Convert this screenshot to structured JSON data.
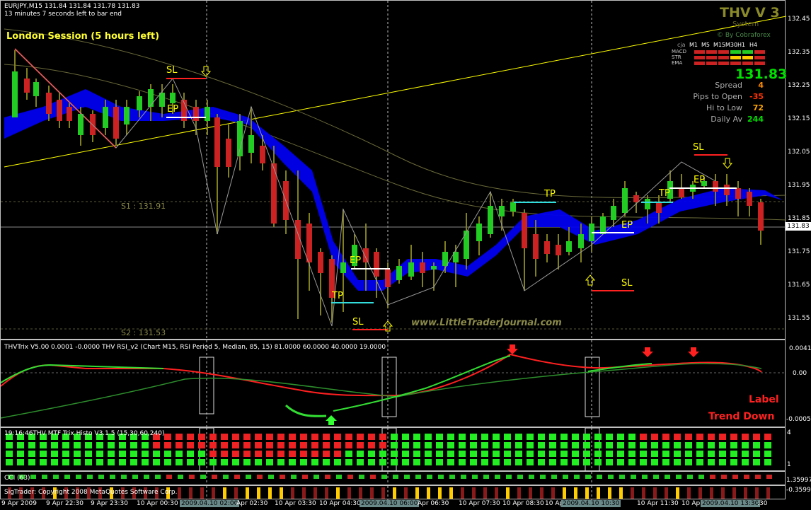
{
  "header": {
    "symbol_line": "EURJPY,M15  131.84 131.84 131.78 131.83",
    "timer_line": "13 minutes 7 seconds left to bar end",
    "session": "London Session (5 hours left)"
  },
  "panel": {
    "title": "THV V 3",
    "subtitle": "System",
    "credit": "© By Cobraforex",
    "tf_headers": [
      "cja",
      "M1",
      "M5",
      "M15",
      "M30",
      "H1",
      "H4"
    ],
    "rows": [
      "MACD",
      "STR",
      "EMA"
    ],
    "price": "131.83",
    "stats": [
      {
        "label": "Spread",
        "value": "4",
        "color": "#ff8c00"
      },
      {
        "label": "Pips to Open",
        "value": "-35",
        "color": "#ff3300"
      },
      {
        "label": "Hi to Low",
        "value": "72",
        "color": "#ffa500"
      },
      {
        "label": "Daily Av",
        "value": "244",
        "color": "#00e000"
      }
    ]
  },
  "levels": {
    "s1": "S1 : 131.91",
    "s2": "S2 : 131.53"
  },
  "markers": {
    "sl": "SL",
    "ep": "EP",
    "tp": "TP"
  },
  "watermark": "www.LittleTraderJournal.com",
  "price_scale": [
    "132.45",
    "132.35",
    "132.25",
    "132.15",
    "132.05",
    "131.95",
    "131.85",
    "131.75",
    "131.65",
    "131.55"
  ],
  "current_price_tag": "131.83",
  "trix": {
    "header": "THVTrix V5.00 0.0001 -0.0000   THV RSI_v2  (Chart M15,  RSI Period 5,  Median,  85,  15)  81.0000 60.0000 40.0000 19.0000",
    "label": "Label",
    "trend": "Trend Down",
    "scale": [
      "0.0041",
      "0.00",
      "-0.0005"
    ]
  },
  "histo": {
    "header": "19:16:46THV MTF Trix Histo V3.1.5  (15,30,60,240)",
    "scale": [
      "4",
      "1"
    ]
  },
  "cci": {
    "header": "CCI (63)",
    "scale": [
      "1.35997",
      "-0.35997"
    ]
  },
  "status": {
    "text": "SigTrader: Copyright 2008 MetaQuotes Software Corp."
  },
  "time_axis": [
    {
      "t": "9 Apr 2009",
      "hl": false
    },
    {
      "t": "9 Apr 22:30",
      "hl": false
    },
    {
      "t": "9 Apr 23:30",
      "hl": false
    },
    {
      "t": "10 Apr 00:30",
      "hl": false
    },
    {
      "t": "2009.04.10 02:00",
      "hl": true
    },
    {
      "t": "Apr 02:30",
      "hl": false
    },
    {
      "t": "10 Apr 03:30",
      "hl": false
    },
    {
      "t": "10 Apr 04:30",
      "hl": false
    },
    {
      "t": "2009.04.10 06:00",
      "hl": true
    },
    {
      "t": "Apr 06:30",
      "hl": false
    },
    {
      "t": "10 Apr 07:30",
      "hl": false
    },
    {
      "t": "10 Apr 08:30",
      "hl": false
    },
    {
      "t": "10 Ap",
      "hl": false
    },
    {
      "t": "2009.04.10 10:30",
      "hl": true
    },
    {
      "t": "10 Apr 11:30",
      "hl": false
    },
    {
      "t": "10 Ap",
      "hl": false
    },
    {
      "t": "2009.04.10 13:30",
      "hl": true
    },
    {
      "t": ":30",
      "hl": false
    }
  ],
  "colors": {
    "bull": "#22cc22",
    "bear": "#cc2222",
    "wick": "#808020",
    "cloud": "#0000ee",
    "trend": "#ffff00"
  }
}
